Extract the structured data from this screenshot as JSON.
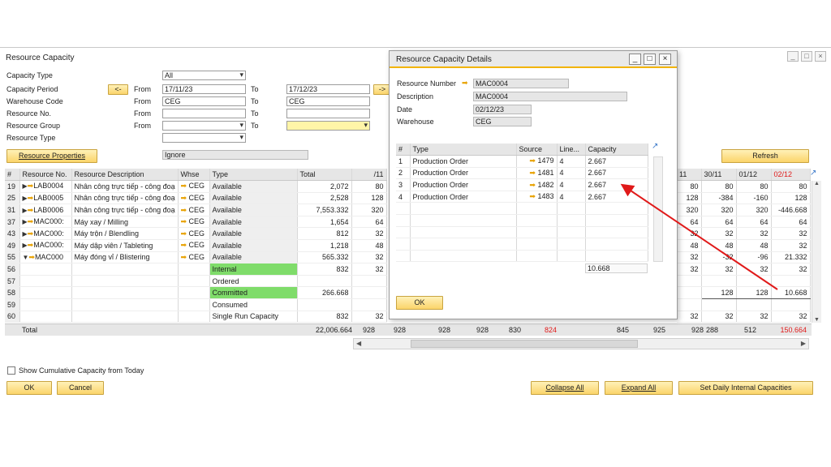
{
  "main_window": {
    "title": "Resource Capacity",
    "controls": [
      "_",
      "□",
      "×"
    ]
  },
  "filters": {
    "capacity_type": {
      "label": "Capacity Type",
      "value": "All"
    },
    "capacity_period": {
      "label": "Capacity Period",
      "nav_label": "<-",
      "from_label": "From",
      "from_value": "17/11/23",
      "to_label": "To",
      "to_value": "17/12/23",
      "next_label": "->"
    },
    "warehouse_code": {
      "label": "Warehouse Code",
      "from_label": "From",
      "from_value": "CEG",
      "to_label": "To",
      "to_value": "CEG"
    },
    "resource_no": {
      "label": "Resource No.",
      "from_label": "From",
      "to_label": "To"
    },
    "resource_group": {
      "label": "Resource Group",
      "from_label": "From",
      "to_label": "To"
    },
    "resource_type": {
      "label": "Resource Type"
    },
    "resource_properties_button": "Resource Properties",
    "ignore_value": "Ignore"
  },
  "grid": {
    "headers": [
      "#",
      "Resource No.",
      "Resource Description",
      "Whse",
      "Type",
      "Total",
      "/11",
      "21",
      "11",
      "30/11",
      "01/12",
      "02/12"
    ],
    "rows": [
      {
        "no": "19",
        "expand": "▶",
        "res": "LAB0004",
        "desc": "Nhân công trực tiếp - công đoạ",
        "whse": "CEG",
        "type": "Available",
        "total": "2,072",
        "c1": "80",
        "r1": "80",
        "r2": "80",
        "r3": "80",
        "r4": "80"
      },
      {
        "no": "25",
        "expand": "▶",
        "res": "LAB0005",
        "desc": "Nhân công trực tiếp - công đoạ",
        "whse": "CEG",
        "type": "Available",
        "total": "2,528",
        "c1": "128",
        "r1": "128",
        "r2": "-384",
        "r3": "-160",
        "r4": "128"
      },
      {
        "no": "31",
        "expand": "▶",
        "res": "LAB0006",
        "desc": "Nhân công trực tiếp - công đoạ",
        "whse": "CEG",
        "type": "Available",
        "total": "7,553.332",
        "c1": "320",
        "r1": "320",
        "r2": "320",
        "r3": "320",
        "r4": "-446.668"
      },
      {
        "no": "37",
        "expand": "▶",
        "res": "MAC000:",
        "desc": "Máy xay / Milling",
        "whse": "CEG",
        "type": "Available",
        "total": "1,654",
        "c1": "64",
        "r1": "64",
        "r2": "64",
        "r3": "64",
        "r4": "64"
      },
      {
        "no": "43",
        "expand": "▶",
        "res": "MAC000:",
        "desc": "Máy trộn / Blendling",
        "whse": "CEG",
        "type": "Available",
        "total": "812",
        "c1": "32",
        "r1": "32",
        "r2": "32",
        "r3": "32",
        "r4": "32"
      },
      {
        "no": "49",
        "expand": "▶",
        "res": "MAC000:",
        "desc": "Máy dập viên / Tableting",
        "whse": "CEG",
        "type": "Available",
        "total": "1,218",
        "c1": "48",
        "r1": "48",
        "r2": "48",
        "r3": "48",
        "r4": "32"
      },
      {
        "no": "55",
        "expand": "▼",
        "res": "MAC000",
        "desc": "Máy đóng vỉ / Blistering",
        "whse": "CEG",
        "type": "Available",
        "total": "565.332",
        "c1": "32",
        "r1": "32",
        "r2": "-32",
        "r3": "-96",
        "r4": "21.332"
      },
      {
        "no": "56",
        "expand": "",
        "res": "",
        "desc": "",
        "whse": "",
        "type": "Internal",
        "total": "832",
        "c1": "32",
        "r1": "32",
        "r2": "32",
        "r3": "32",
        "r4": "32"
      },
      {
        "no": "57",
        "expand": "",
        "res": "",
        "desc": "",
        "whse": "",
        "type": "Ordered",
        "total": "",
        "c1": "",
        "r1": "",
        "r2": "",
        "r3": "",
        "r4": ""
      },
      {
        "no": "58",
        "expand": "",
        "res": "",
        "desc": "",
        "whse": "",
        "type": "Committed",
        "total": "266.668",
        "c1": "",
        "r1": "",
        "r2": "128",
        "r3": "128",
        "r4": "10.668"
      },
      {
        "no": "59",
        "expand": "",
        "res": "",
        "desc": "",
        "whse": "",
        "type": "Consumed",
        "total": "",
        "c1": "",
        "r1": "",
        "r2": "",
        "r3": "",
        "r4": ""
      },
      {
        "no": "60",
        "expand": "",
        "res": "",
        "desc": "",
        "whse": "",
        "type": "Single Run Capacity",
        "total": "832",
        "c1": "32",
        "r1": "32",
        "r2": "32",
        "r3": "32",
        "r4": "32"
      }
    ],
    "total_row": {
      "label": "Total",
      "total": "22,006.664",
      "values": [
        "928",
        "928",
        "928",
        "928",
        "830",
        "824",
        "",
        "845",
        "925",
        "928",
        "288",
        "512",
        "150.664"
      ]
    },
    "refresh_button": "Refresh"
  },
  "bottom": {
    "show_cumulative_label": "Show Cumulative Capacity from Today",
    "ok_button": "OK",
    "cancel_button": "Cancel",
    "collapse_all_button": "Collapse All",
    "expand_all_button": "Expand All",
    "set_daily_button": "Set Daily Internal Capacities"
  },
  "dialog": {
    "title": "Resource Capacity Details",
    "resource_number_label": "Resource Number",
    "resource_number_value": "MAC0004",
    "description_label": "Description",
    "description_value": "MAC0004",
    "date_label": "Date",
    "date_value": "02/12/23",
    "warehouse_label": "Warehouse",
    "warehouse_value": "CEG",
    "headers": [
      "#",
      "Type",
      "Source",
      "Line...",
      "Capacity"
    ],
    "rows": [
      {
        "no": "1",
        "type": "Production Order",
        "source": "1479",
        "line": "4",
        "capacity": "2.667"
      },
      {
        "no": "2",
        "type": "Production Order",
        "source": "1481",
        "line": "4",
        "capacity": "2.667"
      },
      {
        "no": "3",
        "type": "Production Order",
        "source": "1482",
        "line": "4",
        "capacity": "2.667"
      },
      {
        "no": "4",
        "type": "Production Order",
        "source": "1483",
        "line": "4",
        "capacity": "2.667"
      }
    ],
    "total_capacity": "10.668",
    "ok_button": "OK"
  },
  "colors": {
    "accent_yellow": "#fbd46a",
    "highlight_green": "#7fdc6a",
    "negative_red": "#e01a1a",
    "annotation_red": "#e01a1a"
  }
}
